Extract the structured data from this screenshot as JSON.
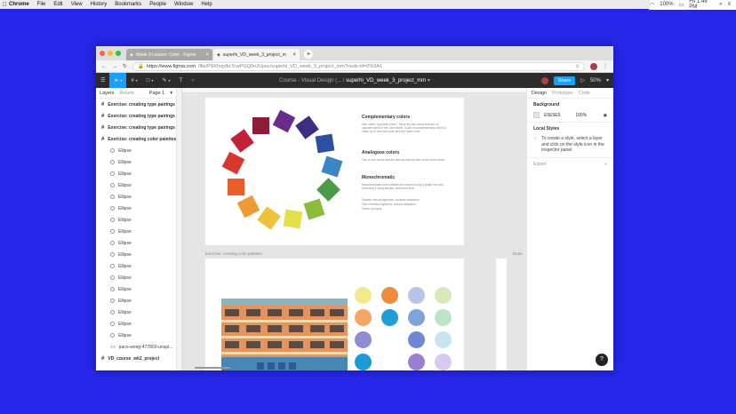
{
  "menubar": {
    "app": "Chrome",
    "items": [
      "File",
      "Edit",
      "View",
      "History",
      "Bookmarks",
      "People",
      "Window",
      "Help"
    ],
    "battery": "100%",
    "clock": "Fri 1:49 PM"
  },
  "browser": {
    "tabs": [
      {
        "title": "Week 3 Lesson: Color - Figma"
      },
      {
        "title": "superhi_VD_week_3_project_m"
      }
    ],
    "url_host": "https://www.figma.com",
    "url_path": "/file/PSKhopfkcTcwPGQ0nJUpec/superhi_VD_week_3_project_mm?node-id=0%3A1"
  },
  "figma_toolbar": {
    "breadcrumb": "Course - Visual Design (...",
    "separator": "/",
    "file_name": "superhi_VD_week_3_project_mm",
    "share_label": "Share",
    "zoom": "50%"
  },
  "layers": {
    "tabs": [
      "Layers",
      "Assets"
    ],
    "page": "Page 1",
    "rows": [
      {
        "label": "Exercise: creating type pairings",
        "kind": "frame"
      },
      {
        "label": "Exercise: creating type pairings",
        "kind": "frame"
      },
      {
        "label": "Exercise: creating type pairings",
        "kind": "frame"
      },
      {
        "label": "Exercise: creating color palettes",
        "kind": "frame"
      },
      {
        "label": "Ellipse",
        "kind": "ellipse"
      },
      {
        "label": "Ellipse",
        "kind": "ellipse"
      },
      {
        "label": "Ellipse",
        "kind": "ellipse"
      },
      {
        "label": "Ellipse",
        "kind": "ellipse"
      },
      {
        "label": "Ellipse",
        "kind": "ellipse"
      },
      {
        "label": "Ellipse",
        "kind": "ellipse"
      },
      {
        "label": "Ellipse",
        "kind": "ellipse"
      },
      {
        "label": "Ellipse",
        "kind": "ellipse"
      },
      {
        "label": "Ellipse",
        "kind": "ellipse"
      },
      {
        "label": "Ellipse",
        "kind": "ellipse"
      },
      {
        "label": "Ellipse",
        "kind": "ellipse"
      },
      {
        "label": "Ellipse",
        "kind": "ellipse"
      },
      {
        "label": "Ellipse",
        "kind": "ellipse"
      },
      {
        "label": "Ellipse",
        "kind": "ellipse"
      },
      {
        "label": "Ellipse",
        "kind": "ellipse"
      },
      {
        "label": "Ellipse",
        "kind": "ellipse"
      },
      {
        "label": "Ellipse",
        "kind": "ellipse"
      },
      {
        "label": "paco-wong-477800-unspl...",
        "kind": "image"
      },
      {
        "label": "VD_course_wk2_project",
        "kind": "frame"
      }
    ]
  },
  "canvas": {
    "frame_label": "Exercise: creating color palettes",
    "frame_label_right": "Deter",
    "sections": [
      {
        "heading": "Complementary colors",
        "body": "Also called \"opposite colors,\" these are two colors that are on opposite sides of the color wheel. A pair of complementary colors is made up of one cold color and one warm color."
      },
      {
        "heading": "Analogous colors",
        "body": "Two or four colors that are directly side-by-side on the color wheel."
      },
      {
        "heading": "Monochromatic",
        "body": "Monochromatic color palettes are created using a single hue and extending it using shades, tones and tints."
      }
    ],
    "mono_lines": [
      "Shades: reduce lightness, increase saturation",
      "Tints: increase lightness, reduce saturation",
      "Tones: add grey"
    ],
    "wheel_colors": [
      "#8e1c3b",
      "#6a2c8c",
      "#3f2d84",
      "#2d4fa3",
      "#3d86c6",
      "#4a9a4a",
      "#8dbb3e",
      "#e5e04a",
      "#f0c23c",
      "#f09a36",
      "#e85f2c",
      "#d9372c",
      "#c2213a"
    ],
    "palette_colors": [
      "#f3e98b",
      "#f08a3c",
      "#b8c4e8",
      "#d7eab7",
      "#f7a566",
      "#1f9ed8",
      "#7fa4d9",
      "#bfe3c7",
      "#8f8cd2",
      "#ffffff",
      "#6f86d4",
      "#c9e4f1",
      "#1a9ad6",
      "#ffffff",
      "#9b7fd3",
      "#d7c9ef"
    ]
  },
  "design_panel": {
    "tabs": [
      "Design",
      "Prototype",
      "Code"
    ],
    "background_title": "Background",
    "bg_hex": "E5E5E5",
    "bg_opacity": "100%",
    "local_styles_title": "Local Styles",
    "local_styles_help": "To create a style, select a layer and click on the style icon in the inspector panel.",
    "export_title": "Export"
  }
}
